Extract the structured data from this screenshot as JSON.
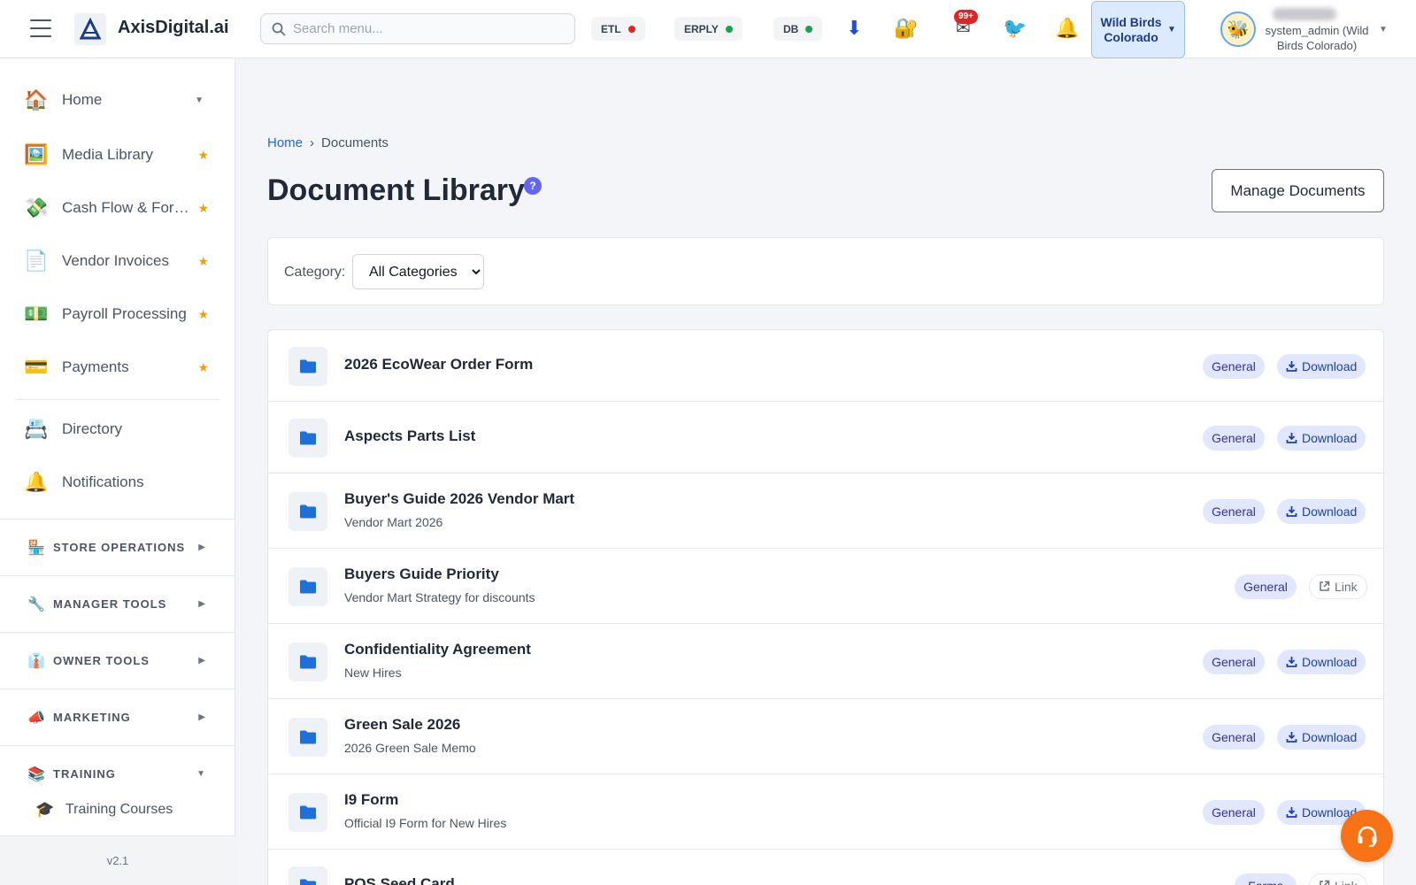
{
  "header": {
    "brand": "AxisDigital.ai",
    "search_placeholder": "Search menu...",
    "status": [
      {
        "label": "ETL",
        "color": "#dc2626"
      },
      {
        "label": "ERPLY",
        "color": "#16a34a"
      },
      {
        "label": "DB",
        "color": "#16a34a"
      }
    ],
    "icons": [
      "download-icon",
      "lock-key-icon",
      "mail-icon",
      "bird-icon",
      "bell-icon"
    ],
    "mail_badge": "99+",
    "store_selector": "Wild Birds Colorado",
    "user_role": "system_admin (Wild Birds Colorado)"
  },
  "sidebar": {
    "items": [
      {
        "label": "Home",
        "icon": "house-icon",
        "marker": "caret"
      },
      {
        "label": "Media Library",
        "icon": "picture-icon",
        "marker": "star"
      },
      {
        "label": "Cash Flow & Forecasting",
        "icon": "money-wings-icon",
        "marker": "star"
      },
      {
        "label": "Vendor Invoices",
        "icon": "document-icon",
        "marker": "star"
      },
      {
        "label": "Payroll Processing",
        "icon": "banknote-icon",
        "marker": "star"
      },
      {
        "label": "Payments",
        "icon": "credit-card-icon",
        "marker": "star"
      },
      {
        "label": "Directory",
        "icon": "card-index-icon",
        "marker": "none"
      },
      {
        "label": "Notifications",
        "icon": "bell-icon",
        "marker": "none"
      }
    ],
    "sections": [
      {
        "label": "STORE OPERATIONS",
        "icon": "store-icon",
        "expanded": false
      },
      {
        "label": "MANAGER TOOLS",
        "icon": "wrench-icon",
        "expanded": false
      },
      {
        "label": "OWNER TOOLS",
        "icon": "suit-icon",
        "expanded": false
      },
      {
        "label": "MARKETING",
        "icon": "megaphone-icon",
        "expanded": false
      },
      {
        "label": "TRAINING",
        "icon": "books-icon",
        "expanded": true
      }
    ],
    "training_item": "Training Courses",
    "version": "v2.1"
  },
  "main": {
    "breadcrumb": {
      "home": "Home",
      "separator": "›",
      "current": "Documents"
    },
    "title": "Document Library",
    "help": "?",
    "manage_button": "Manage Documents",
    "filter": {
      "label": "Category:",
      "selected": "All Categories"
    },
    "documents": [
      {
        "title": "2026 EcoWear Order Form",
        "subtitle": "",
        "category": "General",
        "action": "Download"
      },
      {
        "title": "Aspects Parts List",
        "subtitle": "",
        "category": "General",
        "action": "Download"
      },
      {
        "title": "Buyer's Guide 2026 Vendor Mart",
        "subtitle": "Vendor Mart 2026",
        "category": "General",
        "action": "Download"
      },
      {
        "title": "Buyers Guide Priority",
        "subtitle": "Vendor Mart Strategy for discounts",
        "category": "General",
        "action": "Link"
      },
      {
        "title": "Confidentiality Agreement",
        "subtitle": "New Hires",
        "category": "General",
        "action": "Download"
      },
      {
        "title": "Green Sale 2026",
        "subtitle": "2026 Green Sale Memo",
        "category": "General",
        "action": "Download"
      },
      {
        "title": "I9 Form",
        "subtitle": "Official I9 Form for New Hires",
        "category": "General",
        "action": "Download"
      },
      {
        "title": "POS Seed Card",
        "subtitle": "",
        "category": "Forms",
        "action": "Link"
      }
    ]
  },
  "colors": {
    "accent": "#2563eb",
    "fab": "#f97316",
    "star": "#f59e0b",
    "folder": "#1e6fd9"
  }
}
